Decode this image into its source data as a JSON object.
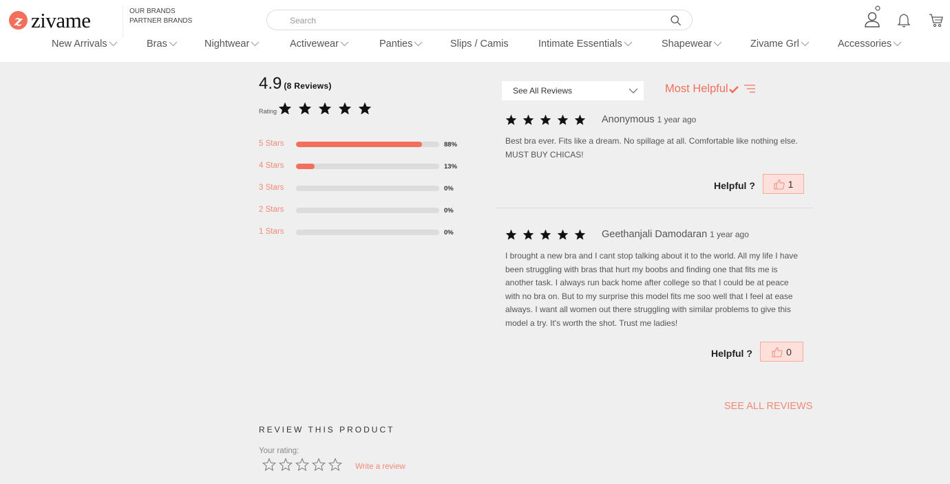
{
  "header": {
    "logo_text": "zivame",
    "logo_badge": "z",
    "brands": [
      "OUR BRANDS",
      "PARTNER BRANDS"
    ],
    "search_placeholder": "Search",
    "icons": [
      "user-icon",
      "bell-icon",
      "cart-icon"
    ]
  },
  "nav": [
    {
      "label": "New Arrivals",
      "dropdown": true
    },
    {
      "label": "Bras",
      "dropdown": true
    },
    {
      "label": "Nightwear",
      "dropdown": true
    },
    {
      "label": "Activewear",
      "dropdown": true
    },
    {
      "label": "Panties",
      "dropdown": true
    },
    {
      "label": "Slips / Camis",
      "dropdown": false
    },
    {
      "label": "Intimate Essentials",
      "dropdown": true
    },
    {
      "label": "Shapewear",
      "dropdown": true
    },
    {
      "label": "Zivame Grl",
      "dropdown": true
    },
    {
      "label": "Accessories",
      "dropdown": true
    }
  ],
  "summary": {
    "average": "4.9",
    "count_text": "(8 Reviews)",
    "rating_label": "Rating",
    "stars": 5,
    "breakdown": [
      {
        "label": "5 Stars",
        "percent": 88,
        "percent_text": "88%"
      },
      {
        "label": "4 Stars",
        "percent": 13,
        "percent_text": "13%"
      },
      {
        "label": "3 Stars",
        "percent": 0,
        "percent_text": "0%"
      },
      {
        "label": "2 Stars",
        "percent": 0,
        "percent_text": "0%"
      },
      {
        "label": "1 Stars",
        "percent": 0,
        "percent_text": "0%"
      }
    ]
  },
  "filter": {
    "selected": "See All Reviews",
    "sort_label": "Most Helpful"
  },
  "reviews": [
    {
      "stars": 5,
      "author": "Anonymous",
      "time": "1 year ago",
      "body": "Best bra ever. Fits like a dream. No spillage at all. Comfortable like nothing else. MUST BUY CHICAS!",
      "helpful_label": "Helpful ?",
      "helpful_count": "1"
    },
    {
      "stars": 5,
      "author": "Geethanjali Damodaran",
      "time": "1 year ago",
      "body": "I brought a new bra and I cant stop talking about it to the world. All my life I have been struggling with bras that hurt my boobs and finding one that fits me is another task. I always run back home after college so that I could be at peace with no bra on. But to my surprise this model fits me soo well that I feel at ease always. I want all women out there struggling with similar problems to give this model a try. It's worth the shot. Trust me ladies!",
      "helpful_label": "Helpful ?",
      "helpful_count": "0"
    }
  ],
  "see_all_label": "SEE ALL REVIEWS",
  "review_product": {
    "heading": "REVIEW THIS PRODUCT",
    "your_rating_label": "Your rating:",
    "write_review_label": "Write a review"
  },
  "colors": {
    "accent": "#f26f5b",
    "accent_light": "#f08a78",
    "helpful_bg": "#fde0db",
    "page_bg": "#efefef"
  }
}
